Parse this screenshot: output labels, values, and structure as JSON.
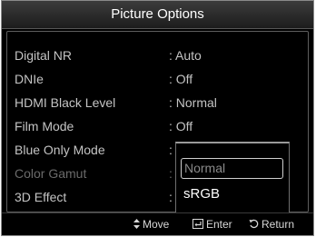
{
  "title": "Picture Options",
  "menu": {
    "items": [
      {
        "label": "Digital NR",
        "value": ": Auto",
        "enabled": true
      },
      {
        "label": "DNIe",
        "value": ": Off",
        "enabled": true
      },
      {
        "label": "HDMI Black Level",
        "value": ": Normal",
        "enabled": true
      },
      {
        "label": "Film Mode",
        "value": ": Off",
        "enabled": true
      },
      {
        "label": "Blue Only Mode",
        "value": ":",
        "enabled": true
      },
      {
        "label": "Color Gamut",
        "value": ":",
        "enabled": false
      },
      {
        "label": "3D Effect",
        "value": ":",
        "enabled": true
      }
    ]
  },
  "dropdown": {
    "options": [
      "Normal",
      "sRGB"
    ],
    "highlighted": "Normal"
  },
  "footer": {
    "move_label": "Move",
    "enter_label": "Enter",
    "return_label": "Return",
    "move_icon": "up-down-arrow-icon",
    "enter_icon": "enter-icon",
    "return_icon": "return-icon"
  },
  "colors": {
    "background": "#000000",
    "text": "#c4c4c4",
    "disabled_text": "#6a6a6a",
    "highlight_border": "#cfcfcf"
  }
}
